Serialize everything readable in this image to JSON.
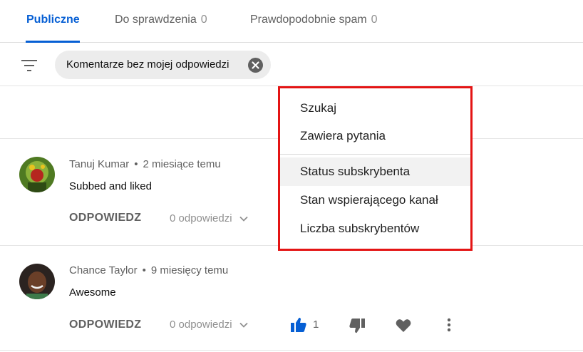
{
  "tabs": [
    {
      "label": "Publiczne",
      "count": ""
    },
    {
      "label": "Do sprawdzenia",
      "count": "0"
    },
    {
      "label": "Prawdopodobnie spam",
      "count": "0"
    }
  ],
  "filter": {
    "icon": "filter-list-icon",
    "chip_label": "Komentarze bez mojej odpowiedzi"
  },
  "comments": [
    {
      "author": "Tanuj Kumar",
      "separator": "•",
      "time": "2 miesiące temu",
      "text": "Subbed and liked",
      "reply_label": "ODPOWIEDZ",
      "replies_label": "0 odpowiedzi"
    },
    {
      "author": "Chance Taylor",
      "separator": "•",
      "time": "9 miesięcy temu",
      "text": "Awesome",
      "reply_label": "ODPOWIEDZ",
      "replies_label": "0 odpowiedzi",
      "like_count": "1"
    }
  ],
  "menu": {
    "items": [
      "Szukaj",
      "Zawiera pytania",
      "Status subskrybenta",
      "Stan wspierającego kanał",
      "Liczba subskrybentów"
    ],
    "highlighted": "Status subskrybenta",
    "border_color": "#e41414"
  },
  "colors": {
    "accent": "#065fd4",
    "muted": "#606060"
  }
}
